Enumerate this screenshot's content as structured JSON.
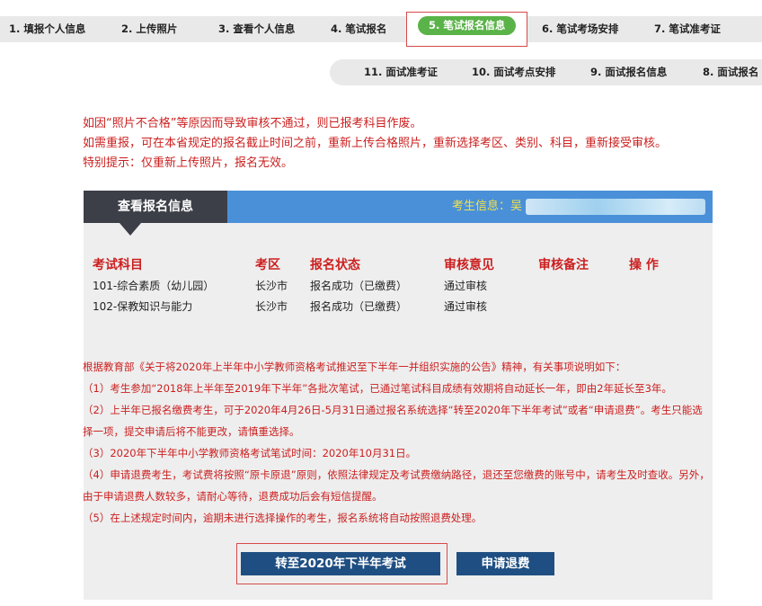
{
  "steps_top": [
    {
      "label": "1. 填报个人信息"
    },
    {
      "label": "2. 上传照片"
    },
    {
      "label": "3. 查看个人信息"
    },
    {
      "label": "4. 笔试报名"
    },
    {
      "label": "5. 笔试报名信息",
      "active": true
    },
    {
      "label": "6. 笔试考场安排"
    },
    {
      "label": "7. 笔试准考证"
    }
  ],
  "steps_bottom": [
    {
      "label": "11. 面试准考证"
    },
    {
      "label": "10. 面试考点安排"
    },
    {
      "label": "9. 面试报名信息"
    },
    {
      "label": "8. 面试报名"
    }
  ],
  "notice_lines": [
    "如因“照片不合格”等原因而导致审核不通过，则已报考科目作废。",
    "如需重报，可在本省规定的报名截止时间之前，重新上传合格照片，重新选择考区、类别、科目，重新接受审核。",
    "特别提示：仅重新上传照片，报名无效。"
  ],
  "panel": {
    "tab_label": "查看报名信息",
    "candidate_label": "考生信息：",
    "candidate_value": "吴"
  },
  "table": {
    "headers": [
      "考试科目",
      "考区",
      "报名状态",
      "审核意见",
      "审核备注",
      "操 作"
    ],
    "rows": [
      [
        "101-综合素质（幼儿园）",
        "长沙市",
        "报名成功（已缴费）",
        "通过审核",
        "",
        ""
      ],
      [
        "102-保教知识与能力",
        "长沙市",
        "报名成功（已缴费）",
        "通过审核",
        "",
        ""
      ]
    ]
  },
  "announcement": [
    "根据教育部《关于将2020年上半年中小学教师资格考试推迟至下半年一并组织实施的公告》精神，有关事项说明如下：",
    "（1）考生参加“2018年上半年至2019年下半年”各批次笔试，已通过笔试科目成绩有效期将自动延长一年，即由2年延长至3年。",
    "（2）上半年已报名缴费考生，可于2020年4月26日-5月31日通过报名系统选择“转至2020年下半年考试”或者“申请退费”。考生只能选择一项，提交申请后将不能更改，请慎重选择。",
    "（3）2020年下半年中小学教师资格考试笔试时间：2020年10月31日。",
    "（4）申请退费考生，考试费将按照“原卡原退”原则，依照法律规定及考试费缴纳路径，退还至您缴费的账号中，请考生及时查收。另外，由于申请退费人数较多，请耐心等待，退费成功后会有短信提醒。",
    "（5）在上述规定时间内，逾期未进行选择操作的考生，报名系统将自动按照退费处理。"
  ],
  "buttons": {
    "transfer": "转至2020年下半年考试",
    "refund": "申请退费"
  },
  "colors": {
    "notice_red": "#cc1f1f",
    "active_step_green": "#5ab348",
    "panel_header_blue": "#4a90d9",
    "button_navy": "#1f4f82",
    "highlight_border": "#d84a4a"
  }
}
